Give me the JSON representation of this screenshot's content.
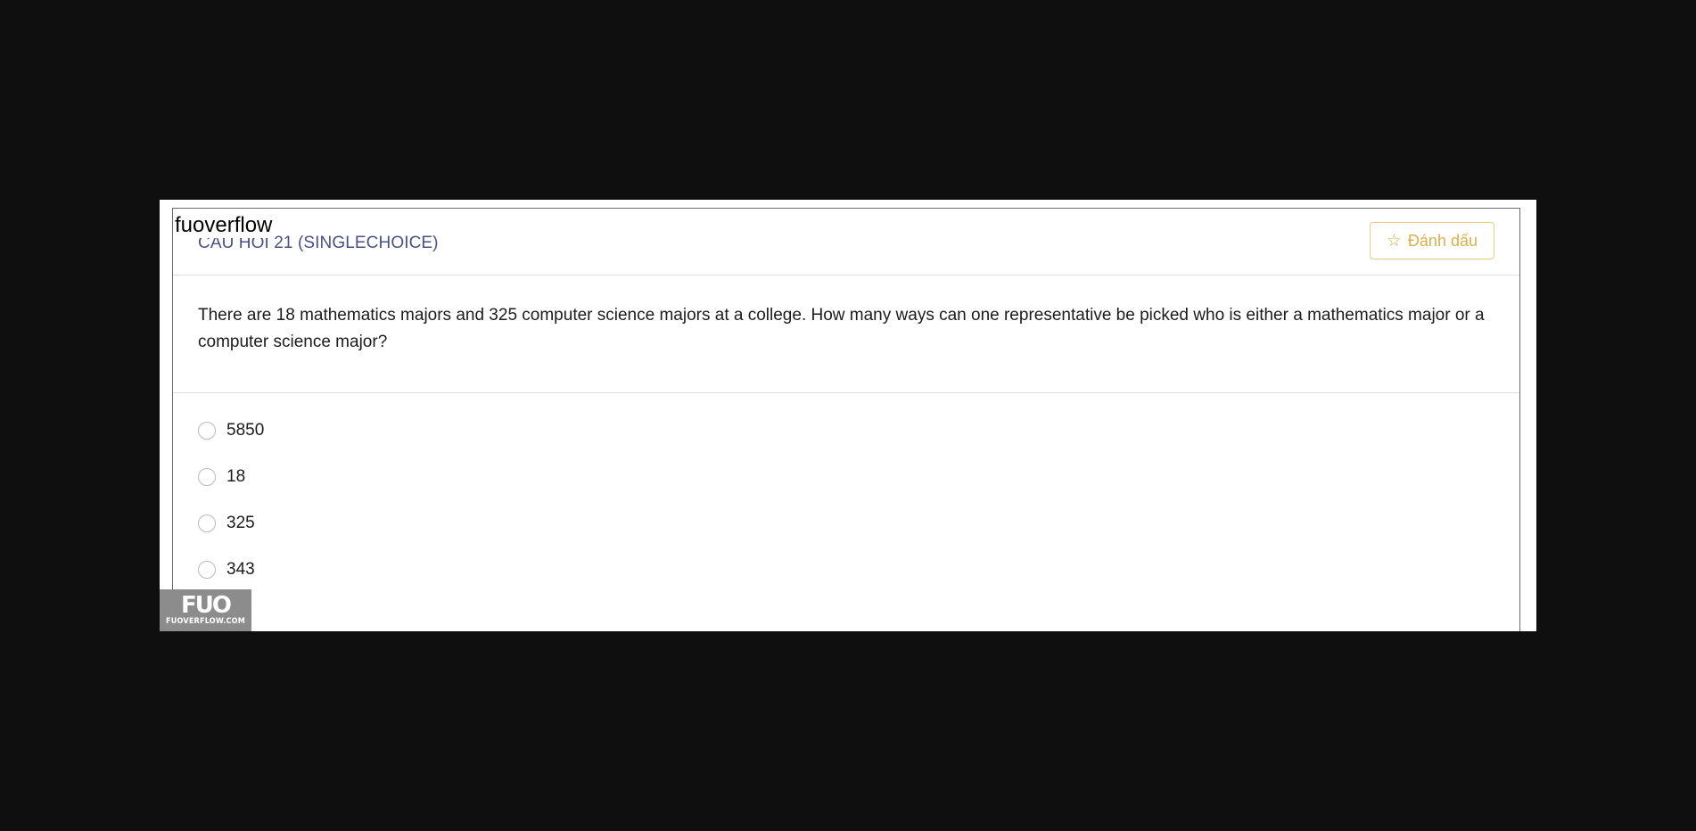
{
  "watermark": {
    "text": "fuoverflow",
    "logo_mark": "FUO",
    "logo_sub": "FUOVERFLOW.COM"
  },
  "question": {
    "title": "CÂU HỎI 21 (SINGLECHOICE)",
    "bookmark_label": "Đánh dấu",
    "bookmark_icon": "star-outline-icon",
    "text": "There are 18 mathematics majors and 325 computer science majors at a college. How many ways can one representative be picked who is either a mathematics major or a computer science major?"
  },
  "answers": [
    {
      "label": "5850"
    },
    {
      "label": "18"
    },
    {
      "label": "325"
    },
    {
      "label": "343"
    }
  ],
  "colors": {
    "title": "#4a4f86",
    "bookmark": "#d9b14c",
    "background": "#0f0f0f"
  }
}
